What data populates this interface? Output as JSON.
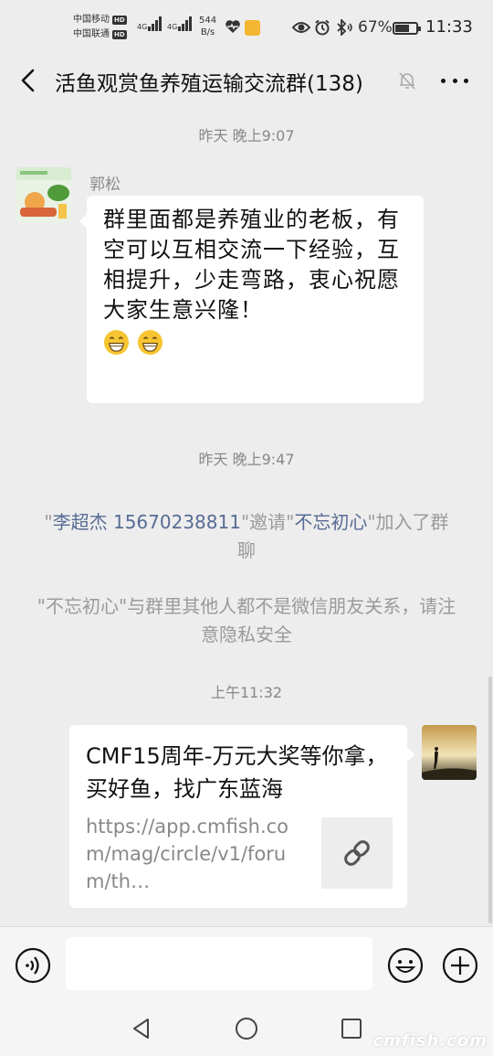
{
  "status_bar": {
    "carrier1": "中国移动",
    "carrier2": "中国联通",
    "hd": "HD",
    "net1": "4G",
    "net2": "4G",
    "speed_value": "544",
    "speed_unit": "B/s",
    "battery_percent": "67%",
    "battery_level": 0.67,
    "time": "11:33"
  },
  "nav": {
    "title": "活鱼观赏鱼养殖运输交流群(138)"
  },
  "messages": {
    "time1": "昨天 晚上9:07",
    "sender1": "郭松",
    "text1": "群里面都是养殖业的老板，有空可以互相交流一下经验，互相提升，少走弯路，衷心祝愿大家生意兴隆！",
    "time2": "昨天 晚上9:47",
    "sys1": {
      "q1": "\"",
      "inviter": "李超杰 15670238811",
      "mid": "\"邀请\"",
      "invitee": "不忘初心",
      "tail": "\"加入了群聊"
    },
    "sys2": "\"不忘初心\"与群里其他人都不是微信朋友关系，请注意隐私安全",
    "time3": "上午11:32",
    "link": {
      "title": "CMF15周年-万元大奖等你拿，买好鱼，找广东蓝海",
      "url": "https://app.cmfish.com/mag/circle/v1/forum/th…"
    }
  },
  "watermark": "cmfish.com",
  "colors": {
    "background": "#ededed",
    "link_blue": "#576b95",
    "system_text": "#9a9a9a"
  }
}
